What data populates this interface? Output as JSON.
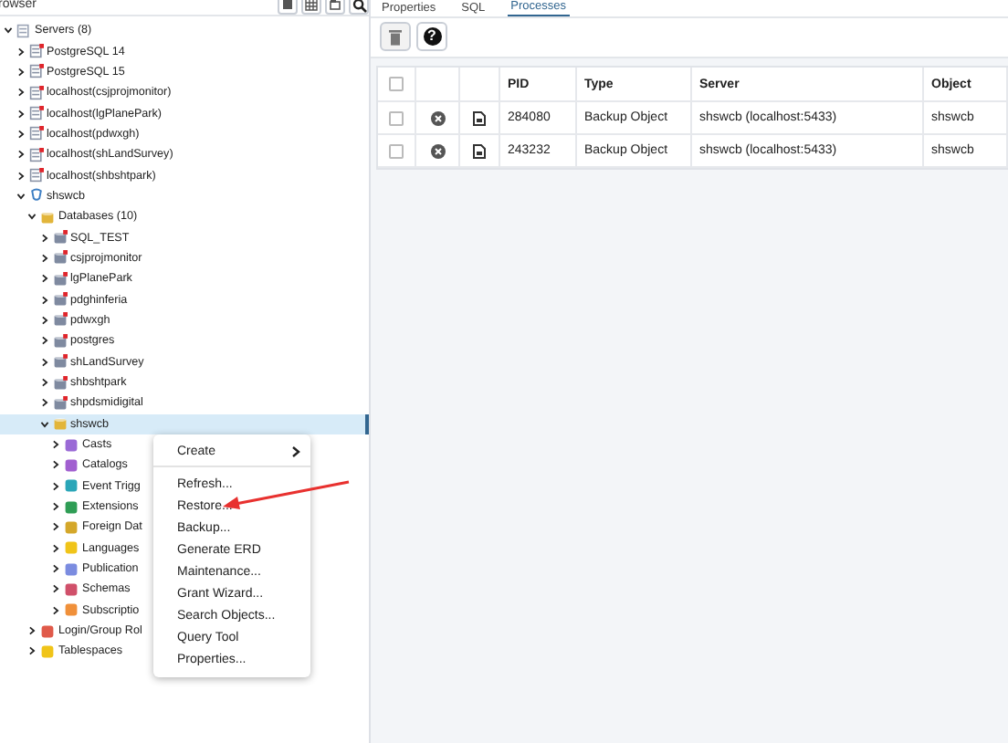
{
  "browser": {
    "title": "rowser",
    "tree": [
      {
        "label": "Servers (8)",
        "kind": "server-group",
        "expanded": true,
        "selected": false,
        "children": [
          {
            "label": "PostgreSQL 14",
            "kind": "server-off",
            "expanded": false,
            "selected": false
          },
          {
            "label": "PostgreSQL 15",
            "kind": "server-off",
            "expanded": false,
            "selected": false
          },
          {
            "label": "localhost(csjprojmonitor)",
            "kind": "server-off",
            "expanded": false,
            "selected": false
          },
          {
            "label": "localhost(lgPlanePark)",
            "kind": "server-off",
            "expanded": false,
            "selected": false
          },
          {
            "label": "localhost(pdwxgh)",
            "kind": "server-off",
            "expanded": false,
            "selected": false
          },
          {
            "label": "localhost(shLandSurvey)",
            "kind": "server-off",
            "expanded": false,
            "selected": false
          },
          {
            "label": "localhost(shbshtpark)",
            "kind": "server-off",
            "expanded": false,
            "selected": false
          },
          {
            "label": "shswcb",
            "kind": "server-on",
            "expanded": true,
            "selected": false,
            "children": [
              {
                "label": "Databases (10)",
                "kind": "databases",
                "expanded": true,
                "selected": false,
                "children": [
                  {
                    "label": "SQL_TEST",
                    "kind": "db-off",
                    "expanded": false,
                    "selected": false
                  },
                  {
                    "label": "csjprojmonitor",
                    "kind": "db-off",
                    "expanded": false,
                    "selected": false
                  },
                  {
                    "label": "lgPlanePark",
                    "kind": "db-off",
                    "expanded": false,
                    "selected": false
                  },
                  {
                    "label": "pdghinferia",
                    "kind": "db-off",
                    "expanded": false,
                    "selected": false
                  },
                  {
                    "label": "pdwxgh",
                    "kind": "db-off",
                    "expanded": false,
                    "selected": false
                  },
                  {
                    "label": "postgres",
                    "kind": "db-off",
                    "expanded": false,
                    "selected": false
                  },
                  {
                    "label": "shLandSurvey",
                    "kind": "db-off",
                    "expanded": false,
                    "selected": false
                  },
                  {
                    "label": "shbshtpark",
                    "kind": "db-off",
                    "expanded": false,
                    "selected": false
                  },
                  {
                    "label": "shpdsmidigital",
                    "kind": "db-off",
                    "expanded": false,
                    "selected": false
                  },
                  {
                    "label": "shswcb",
                    "kind": "db-on",
                    "expanded": true,
                    "selected": true,
                    "children": [
                      {
                        "label": "Casts",
                        "kind": "casts",
                        "expanded": false,
                        "selected": false
                      },
                      {
                        "label": "Catalogs",
                        "kind": "catalogs",
                        "expanded": false,
                        "selected": false
                      },
                      {
                        "label": "Event Trigg",
                        "kind": "event-triggers",
                        "expanded": false,
                        "selected": false
                      },
                      {
                        "label": "Extensions",
                        "kind": "extensions",
                        "expanded": false,
                        "selected": false
                      },
                      {
                        "label": "Foreign Dat",
                        "kind": "foreign-data",
                        "expanded": false,
                        "selected": false
                      },
                      {
                        "label": "Languages",
                        "kind": "languages",
                        "expanded": false,
                        "selected": false
                      },
                      {
                        "label": "Publication",
                        "kind": "publications",
                        "expanded": false,
                        "selected": false
                      },
                      {
                        "label": "Schemas",
                        "kind": "schemas",
                        "expanded": false,
                        "selected": false
                      },
                      {
                        "label": "Subscriptio",
                        "kind": "subscriptions",
                        "expanded": false,
                        "selected": false
                      }
                    ]
                  }
                ]
              },
              {
                "label": "Login/Group Rol",
                "kind": "roles",
                "expanded": false,
                "selected": false
              },
              {
                "label": "Tablespaces",
                "kind": "tablespaces",
                "expanded": false,
                "selected": false
              }
            ]
          }
        ]
      }
    ]
  },
  "context_menu": {
    "items": [
      {
        "label": "Create",
        "submenu": true
      },
      {
        "label": "Refresh...",
        "submenu": false
      },
      {
        "label": "Restore...",
        "submenu": false
      },
      {
        "label": "Backup...",
        "submenu": false
      },
      {
        "label": "Generate ERD",
        "submenu": false
      },
      {
        "label": "Maintenance...",
        "submenu": false
      },
      {
        "label": "Grant Wizard...",
        "submenu": false
      },
      {
        "label": "Search Objects...",
        "submenu": false
      },
      {
        "label": "Query Tool",
        "submenu": false
      },
      {
        "label": "Properties...",
        "submenu": false
      }
    ]
  },
  "tabs": [
    {
      "label": "Properties",
      "selected": false
    },
    {
      "label": "SQL",
      "selected": false
    },
    {
      "label": "Processes",
      "selected": true
    }
  ],
  "toolbar": [
    {
      "kind": "delete",
      "disabled": true
    },
    {
      "kind": "help",
      "label": "?",
      "disabled": false
    }
  ],
  "processes": {
    "select_all": {
      "checked": false
    },
    "columns": [
      "PID",
      "Type",
      "Server",
      "Object"
    ],
    "rows": [
      {
        "checked": false,
        "cells": [
          "284080",
          "Backup Object",
          "shswcb (localhost:5433)",
          "shswcb"
        ]
      },
      {
        "checked": false,
        "cells": [
          "243232",
          "Backup Object",
          "shswcb (localhost:5433)",
          "shswcb"
        ]
      }
    ]
  }
}
